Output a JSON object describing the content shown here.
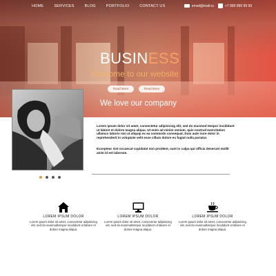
{
  "nav": {
    "items": [
      "HOME",
      "SERVICES",
      "BLOG",
      "PORTFOLIO",
      "CONTACT US"
    ],
    "email": "email@mail.ru",
    "phone": "+7 999 999 99 99"
  },
  "hero": {
    "brand_part1": "BUSIN",
    "brand_part2": "ESS",
    "welcome": "Welcome to our website",
    "button1": "Read More",
    "button2": "Read More",
    "love": "We love our company"
  },
  "slider": {
    "count": 4,
    "active": 0
  },
  "content": {
    "paragraph1": "Lorem ipsum dolor sit amet, consectetur adipisicing elit, sed do eiusmod tempor incididunt ut labore et dolore magna aliqua. Ut enim ad minim veniam, quis nostrud exercitation ullamco laboris nisi ut aliquip ex ea commodo consequat. Duis aute irure dolor in reprehenderit in voluptate velit esse cillum dolore eu fugiat nulla pariatur.",
    "paragraph2": "Excepteur sint occaecat cupidatat non proident, sunt in culpa qui officia deserunt mollit anim id est laborum."
  },
  "features": [
    {
      "icon": "home-icon",
      "title": "LOREM IPSUM DOLOR",
      "text": "Lorem ipsum dolor sit amet, consectetur adipisicing elit, sed do eiusmodtempor incididunt ut labore et dolore magna aliqua."
    },
    {
      "icon": "monitor-icon",
      "title": "LOREM IPSUM DOLOR",
      "text": "Lorem ipsum dolor sit amet, consectetur adipisicing elit, sed do eiusmodtempor incididunt ut labore et dolore magna aliqua."
    },
    {
      "icon": "coffee-icon",
      "title": "LOREM IPSUM DOLOR",
      "text": "Lorem ipsum dolor sit amet, consectetur adipisicing elit, sed do eiusmodtempor incididunt ut labore et dolore magna aliqua."
    }
  ],
  "colors": {
    "accent": "#f4a066",
    "dot_active": "#e0a23a"
  }
}
